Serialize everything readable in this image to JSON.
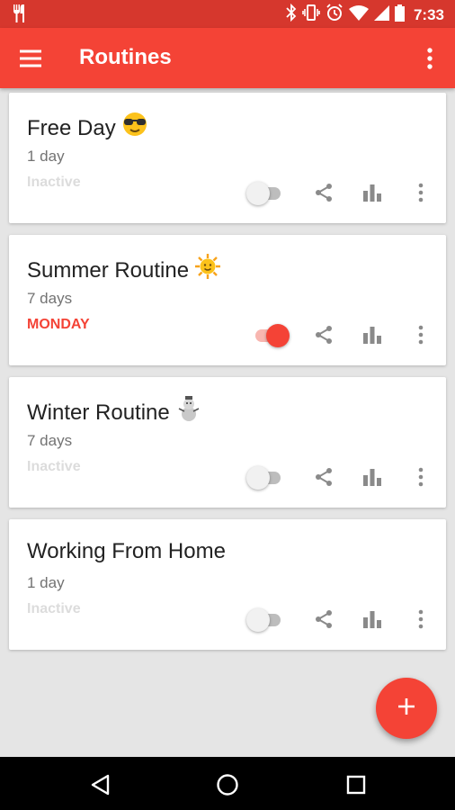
{
  "status_bar": {
    "time": "7:33",
    "icons": [
      "silverware-icon",
      "bluetooth-icon",
      "vibrate-icon",
      "alarm-icon",
      "wifi-icon",
      "signal-icon",
      "battery-icon"
    ]
  },
  "app_bar": {
    "title": "Routines",
    "icons": [
      "menu-icon",
      "more-vert-icon"
    ]
  },
  "routines": [
    {
      "name": "Free Day",
      "emoji": "sunglasses-emoji",
      "days": "1 day",
      "status": "Inactive",
      "active": false
    },
    {
      "name": "Summer Routine",
      "emoji": "sun-emoji",
      "days": "7 days",
      "status": "MONDAY",
      "active": true
    },
    {
      "name": "Winter Routine",
      "emoji": "snowman-emoji",
      "days": "7 days",
      "status": "Inactive",
      "active": false
    },
    {
      "name": "Working From Home",
      "emoji": "",
      "days": "1 day",
      "status": "Inactive",
      "active": false
    }
  ],
  "fab": {
    "icon": "plus-icon"
  },
  "nav_bar": {
    "icons": [
      "back-icon",
      "home-icon",
      "recents-icon"
    ]
  },
  "colors": {
    "primary": "#f44336",
    "status_bar": "#d6372d",
    "background": "#e5e5e5"
  }
}
